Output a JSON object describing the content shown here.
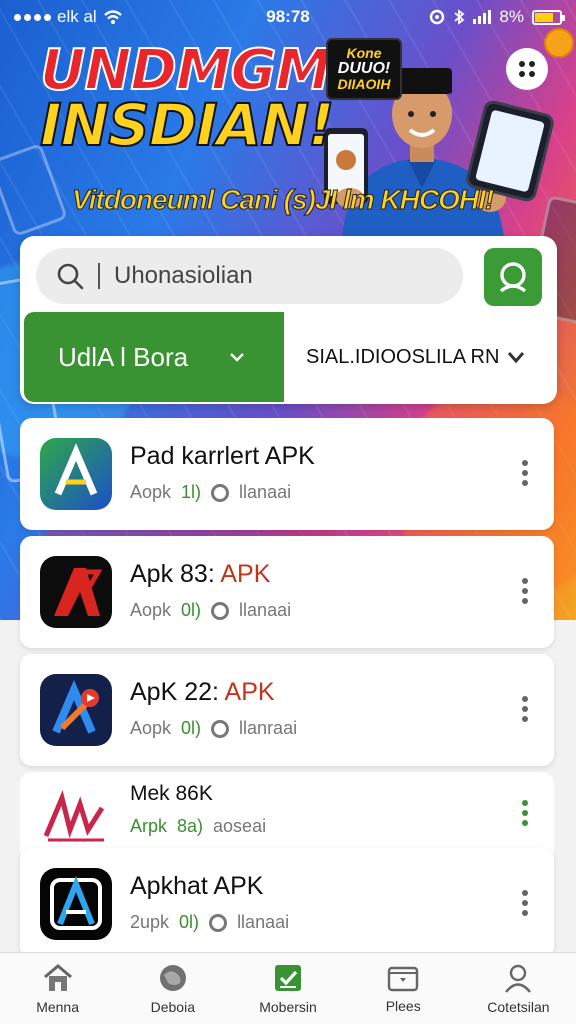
{
  "status_bar": {
    "carrier": "elk al",
    "time": "98:78",
    "battery": "8%",
    "battery_level": 0.7
  },
  "banner": {
    "title_line1": "UNDMGM",
    "title_line2": "INSDIAN!",
    "subtitle": "Vitdoneuml Cani (s)JI lm KHCOHI!",
    "badge_line1": "Kone",
    "badge_line2": "DUUO!",
    "badge_line3": "DIIAOIH"
  },
  "search": {
    "placeholder": "Uhonasiolian"
  },
  "tabs": {
    "active_label": "UdlA l Bora",
    "other_label": "SIAL.IDIOOSLILA RN"
  },
  "apps": [
    {
      "name": "Pad karrlert APK",
      "name_accent": "",
      "meta1": "Aopk",
      "version": "1l)",
      "meta2": "llanaai"
    },
    {
      "name": "Apk 83: ",
      "name_accent": "APK",
      "meta1": "Aopk",
      "version": "0l)",
      "meta2": "llanaai"
    },
    {
      "name": "ApK 22: ",
      "name_accent": "APK",
      "meta1": "Aopk",
      "version": "0l)",
      "meta2": "llanraai"
    },
    {
      "name": "Mek 86K",
      "name_accent": "",
      "meta1": "Arpk",
      "version": "8a)",
      "meta2": "aoseai"
    },
    {
      "name": "Apkhat APK",
      "name_accent": "",
      "meta1": "2upk",
      "version": "0l)",
      "meta2": "llanaai"
    }
  ],
  "nav": [
    {
      "label": "Menna",
      "icon": "home-icon"
    },
    {
      "label": "Deboia",
      "icon": "globe-icon"
    },
    {
      "label": "Mobersin",
      "icon": "check-doc-icon"
    },
    {
      "label": "Plees",
      "icon": "folder-icon"
    },
    {
      "label": "Cotetsilan",
      "icon": "person-icon"
    }
  ],
  "colors": {
    "accent_green": "#3a9332",
    "apk_red": "#c0361c",
    "banner_yellow": "#ffd21f",
    "banner_red": "#e8262b"
  }
}
